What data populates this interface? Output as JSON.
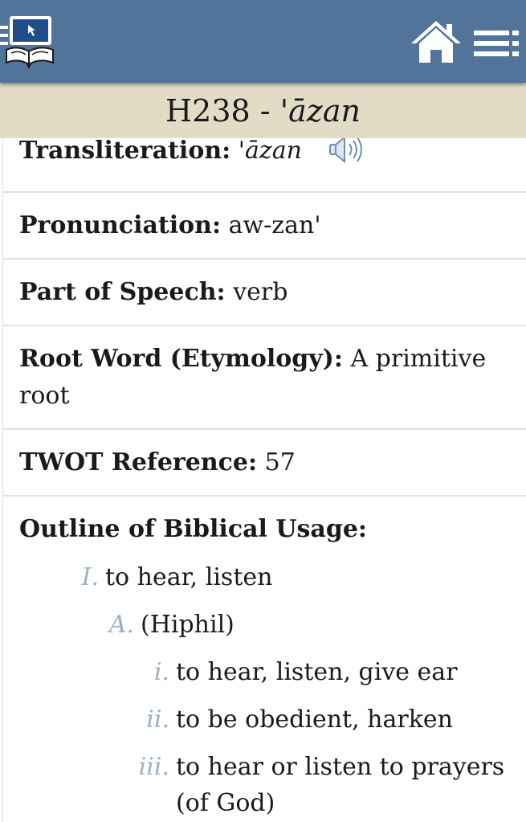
{
  "header": {
    "logo_icon": "bible-computer-logo-icon",
    "home_icon": "home-icon",
    "menu_icon": "menu-icon",
    "bar_color": "#52739a"
  },
  "title": {
    "code": "H238",
    "separator": " - ",
    "word": "'āzan",
    "background": "#e2dbc6"
  },
  "entry": {
    "transliteration": {
      "label": "Transliteration:",
      "value": "'āzan",
      "audio_icon": "speaker-icon"
    },
    "pronunciation": {
      "label": "Pronunciation:",
      "value": "aw-zan'"
    },
    "part_of_speech": {
      "label": "Part of Speech:",
      "value": "verb"
    },
    "root_word": {
      "label": "Root Word (Etymology):",
      "value": "A primitive root"
    },
    "twot": {
      "label": "TWOT Reference:",
      "value": "57"
    },
    "outline": {
      "label": "Outline of Biblical Usage:",
      "items": [
        {
          "marker": "I.",
          "text": "to hear, listen"
        },
        {
          "marker": "A.",
          "text": "(Hiphil)"
        },
        {
          "marker": "i.",
          "text": "to hear, listen, give ear"
        },
        {
          "marker": "ii.",
          "text": "to be obedient, harken"
        },
        {
          "marker": "iii.",
          "text": "to hear or listen to prayers (of God)"
        }
      ]
    }
  }
}
